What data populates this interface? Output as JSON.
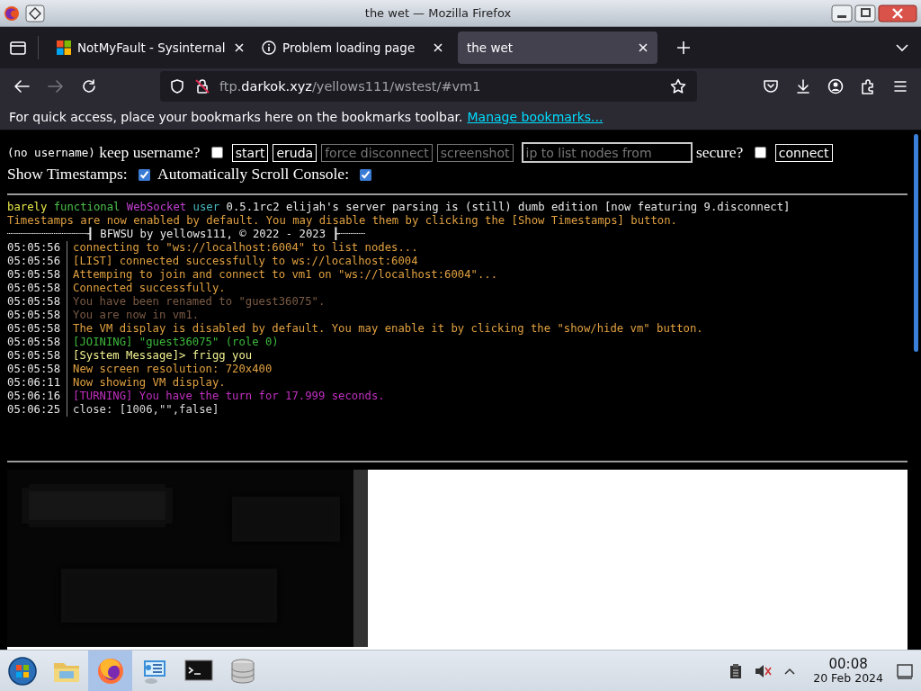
{
  "window": {
    "title": "the wet — Mozilla Firefox"
  },
  "tabs": [
    {
      "label": "NotMyFault - Sysinternal",
      "kind": "windows",
      "selected": false
    },
    {
      "label": "Problem loading page",
      "kind": "info",
      "selected": false
    },
    {
      "label": "the wet",
      "kind": "none",
      "selected": true
    }
  ],
  "address": {
    "prefix": "ftp.",
    "domain": "darkok.xyz",
    "path": "/yellows111/wstest/#vm1"
  },
  "bookmarks_bar": {
    "message": "For quick access, place your bookmarks here on the bookmarks toolbar.",
    "link": "Manage bookmarks..."
  },
  "controls": [
    {
      "kind": "note",
      "text": "(no username)"
    },
    {
      "kind": "label",
      "text": "keep username?"
    },
    {
      "kind": "checkbox",
      "checked": false
    },
    {
      "kind": "button",
      "text": "start",
      "disabled": false
    },
    {
      "kind": "button",
      "text": "eruda",
      "disabled": false
    },
    {
      "kind": "button",
      "text": "force disconnect",
      "disabled": true
    },
    {
      "kind": "button",
      "text": "screenshot",
      "disabled": true
    },
    {
      "kind": "input",
      "placeholder": "ip to list nodes from"
    },
    {
      "kind": "label",
      "text": "secure?"
    },
    {
      "kind": "checkbox",
      "checked": false
    },
    {
      "kind": "button",
      "text": "connect",
      "disabled": false
    },
    {
      "kind": "label",
      "text": "Show Timestamps:"
    },
    {
      "kind": "checkbox",
      "checked": true
    },
    {
      "kind": "label",
      "text": "Automatically Scroll Console:"
    },
    {
      "kind": "checkbox",
      "checked": true
    }
  ],
  "console": {
    "header": [
      {
        "text": "barely",
        "color": "#e6e64a"
      },
      {
        "text": "functional",
        "color": "#4cc04c"
      },
      {
        "text": "WebSocket",
        "color": "#c040d0"
      },
      {
        "text": "user",
        "color": "#48b8c0"
      },
      {
        "text": "0.5.1rc2 elijah's server parsing is (still) dumb edition [now featuring 9.disconnect]",
        "color": "#e8e8e8"
      }
    ],
    "notice": "Timestamps are now enabled by default. You may disable them by clicking the [Show Timestamps] button.",
    "banner": "┈┈┈┈┈┈┈┈┈┈┈┈┨ BFWSU by yellows111, © 2022 - 2023 ┠┈┈┈┈",
    "log": [
      {
        "time": "05:05:56",
        "text": "connecting to \"ws://localhost:6004\" to list nodes...",
        "color": "#e0a040"
      },
      {
        "time": "05:05:56",
        "text": "[LIST] connected successfully to ws://localhost:6004",
        "color": "#e0a040"
      },
      {
        "time": "05:05:58",
        "text": "Attemping to join and connect to vm1 on \"ws://localhost:6004\"...",
        "color": "#e0a040"
      },
      {
        "time": "05:05:58",
        "text": "Connected successfully.",
        "color": "#e0a040"
      },
      {
        "time": "05:05:58",
        "text": "You have been renamed to \"guest36075\".",
        "color": "#7a5a44"
      },
      {
        "time": "05:05:58",
        "text": "You are now in vm1.",
        "color": "#7a5a44"
      },
      {
        "time": "05:05:58",
        "text": "The VM display is disabled by default. You may enable it by clicking the \"show/hide vm\" button.",
        "color": "#e0a040"
      },
      {
        "time": "05:05:58",
        "text": "[JOINING] \"guest36075\" (role 0)",
        "color": "#3cb83c"
      },
      {
        "time": "05:05:58",
        "text": "[System Message]> frigg you",
        "color": "#f0f090"
      },
      {
        "time": "05:05:58",
        "text": "New screen resolution: 720x400",
        "color": "#e0a040"
      },
      {
        "time": "05:06:11",
        "text": "Now showing VM display.",
        "color": "#e0a040"
      },
      {
        "time": "05:06:16",
        "text": "[TURNING] You have the turn for 17.999 seconds.",
        "color": "#c030c0"
      },
      {
        "time": "05:06:25",
        "text": "close: [1006,\"\",false]",
        "color": "#d8d8d8"
      }
    ]
  },
  "taskbar": {
    "apps": [
      {
        "kind": "start",
        "selected": false
      },
      {
        "kind": "folder",
        "selected": false
      },
      {
        "kind": "firefox",
        "selected": true
      },
      {
        "kind": "network",
        "selected": false
      },
      {
        "kind": "terminal",
        "selected": false
      },
      {
        "kind": "database",
        "selected": false
      }
    ],
    "time": "00:08",
    "date": "20 Feb 2024"
  }
}
